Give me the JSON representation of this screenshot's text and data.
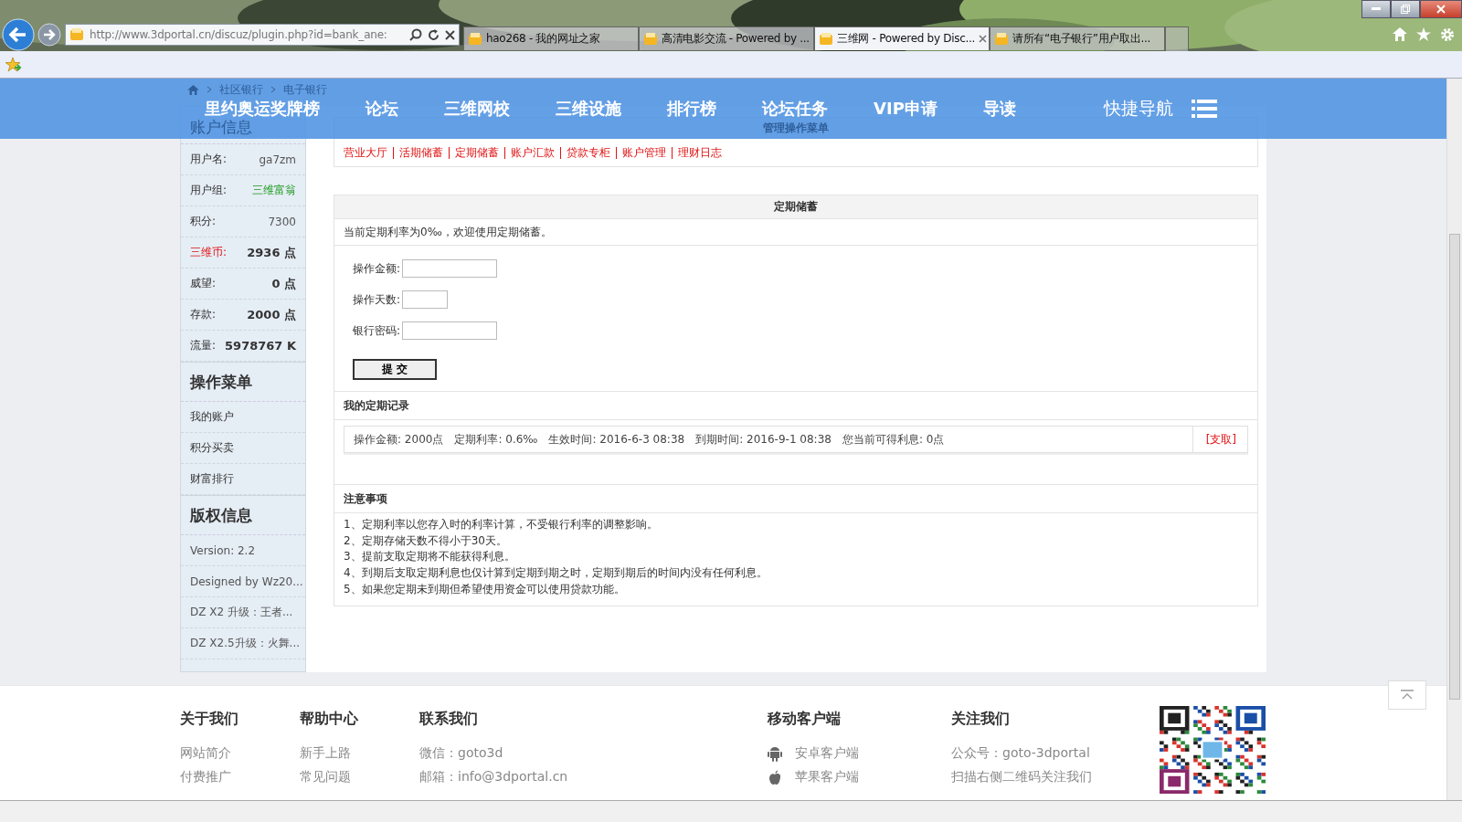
{
  "browser": {
    "url": "http://www.3dportal.cn/discuz/plugin.php?id=bank_ane:",
    "tabs": [
      {
        "title": "hao268 - 我的网址之家",
        "selected": false
      },
      {
        "title": "高清电影交流 - Powered by ...",
        "selected": false
      },
      {
        "title": "三维网 - Powered by Disc...",
        "selected": true
      },
      {
        "title": "请所有“电子银行”用户取出...",
        "selected": false
      }
    ]
  },
  "breadcrumb": [
    "社区银行",
    "电子银行"
  ],
  "nav": {
    "items": [
      "里约奥运奖牌榜",
      "论坛",
      "三维网校",
      "三维设施",
      "排行榜",
      "论坛任务",
      "VIP申请",
      "导读"
    ],
    "quick": "快捷导航"
  },
  "sidebar": {
    "account_title": "账户信息",
    "fields": [
      {
        "label": "用户名:",
        "value": "ga7zm",
        "kind": "plain"
      },
      {
        "label": "用户组:",
        "value": "三维富翁",
        "kind": "group"
      },
      {
        "label": "积分:",
        "value": "7300",
        "kind": "plain"
      },
      {
        "label": "三维币:",
        "value": "2936 点",
        "kind": "currency"
      },
      {
        "label": "威望:",
        "value": "0 点",
        "kind": "bold"
      },
      {
        "label": "存款:",
        "value": "2000 点",
        "kind": "bold"
      },
      {
        "label": "流量:",
        "value": "5978767 K",
        "kind": "bold"
      }
    ],
    "menu_title": "操作菜单",
    "menu_items": [
      "我的账户",
      "积分买卖",
      "财富排行"
    ],
    "copyright_title": "版权信息",
    "copyright_items": [
      "Version: 2.2",
      "Designed by Wz20...",
      "DZ X2 升级：王者...",
      "DZ X2.5升级：火舞..."
    ]
  },
  "manage": {
    "title": "管理操作菜单",
    "links": [
      "营业大厅",
      "活期储蓄",
      "定期储蓄",
      "账户汇款",
      "贷款专柜",
      "账户管理",
      "理财日志"
    ]
  },
  "deposit": {
    "title": "定期储蓄",
    "notice": "当前定期利率为0‰，欢迎使用定期储蓄。",
    "fields": [
      {
        "label": "操作金额:",
        "kind": "wide"
      },
      {
        "label": "操作天数:",
        "kind": "short"
      },
      {
        "label": "银行密码:",
        "kind": "wide"
      }
    ],
    "submit": "提 交",
    "records_title": "我的定期记录",
    "record": [
      "操作金额: 2000点",
      "定期利率: 0.6‰",
      "生效时间: 2016-6-3 08:38",
      "到期时间: 2016-9-1 08:38",
      "您当前可得利息: 0点"
    ],
    "record_action": "[支取]",
    "notes_title": "注意事项",
    "notes": [
      "1、定期利率以您存入时的利率计算，不受银行利率的调整影响。",
      "2、定期存储天数不得小于30天。",
      "3、提前支取定期将不能获得利息。",
      "4、到期后支取定期利息也仅计算到定期到期之时，定期到期后的时间内没有任何利息。",
      "5、如果您定期未到期但希望使用资金可以使用贷款功能。"
    ]
  },
  "footer": {
    "columns": [
      {
        "title": "关于我们",
        "links": [
          {
            "text": "网站简介",
            "kind": "text"
          },
          {
            "text": "付费推广",
            "kind": "text"
          }
        ]
      },
      {
        "title": "帮助中心",
        "links": [
          {
            "text": "新手上路",
            "kind": "text"
          },
          {
            "text": "常见问题",
            "kind": "text"
          }
        ]
      },
      {
        "title": "联系我们",
        "links": [
          {
            "text": "微信：goto3d",
            "kind": "text"
          },
          {
            "text": "邮箱：info@3dportal.cn",
            "kind": "text"
          }
        ]
      },
      {
        "title": "移动客户端",
        "links": [
          {
            "text": "安卓客户端",
            "kind": "android"
          },
          {
            "text": "苹果客户端",
            "kind": "apple"
          }
        ]
      },
      {
        "title": "关注我们",
        "links": [
          {
            "text": "公众号：goto-3dportal",
            "kind": "text"
          },
          {
            "text": "扫描右侧二维码关注我们",
            "kind": "text"
          }
        ]
      }
    ]
  }
}
